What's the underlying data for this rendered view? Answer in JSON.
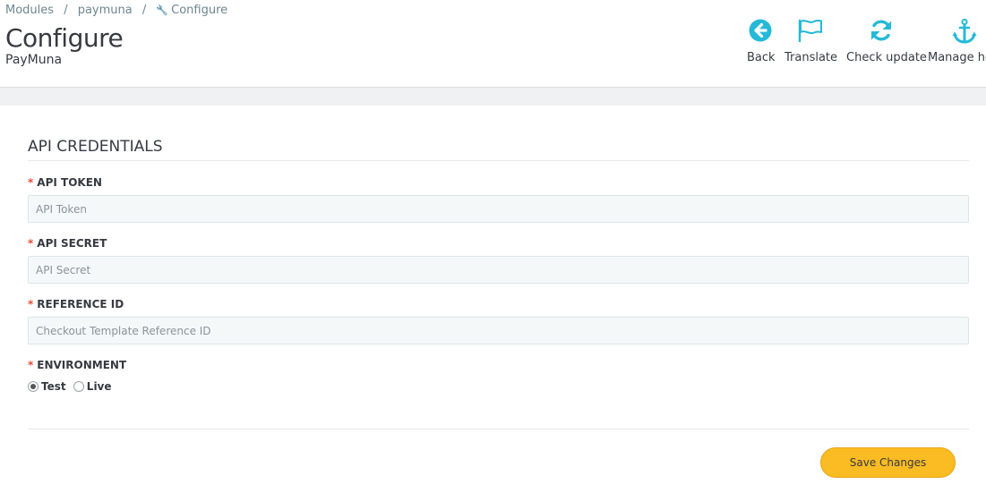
{
  "breadcrumb": {
    "items": [
      "Modules",
      "paymuna",
      "Configure"
    ],
    "separator": "/"
  },
  "page": {
    "title": "Configure",
    "subtitle": "PayMuna"
  },
  "toolbar": {
    "back_label": "Back",
    "translate_label": "Translate",
    "check_update_label": "Check update",
    "manage_hooks_label": "Manage hooks",
    "icon_color": "#25b9d7"
  },
  "form": {
    "section_title": "API CREDENTIALS",
    "required_marker": "*",
    "fields": [
      {
        "label": "API TOKEN",
        "value": "",
        "placeholder": "API Token"
      },
      {
        "label": "API SECRET",
        "value": "",
        "placeholder": "API Secret"
      },
      {
        "label": "REFERENCE ID",
        "value": "",
        "placeholder": "Checkout Template Reference ID"
      }
    ],
    "environment": {
      "label": "ENVIRONMENT",
      "options": [
        {
          "label": "Test",
          "checked": true
        },
        {
          "label": "Live",
          "checked": false
        }
      ]
    },
    "save_label": "Save Changes"
  },
  "colors": {
    "accent": "#25b9d7",
    "save_button": "#fbbb22",
    "required": "#e84e3c"
  }
}
